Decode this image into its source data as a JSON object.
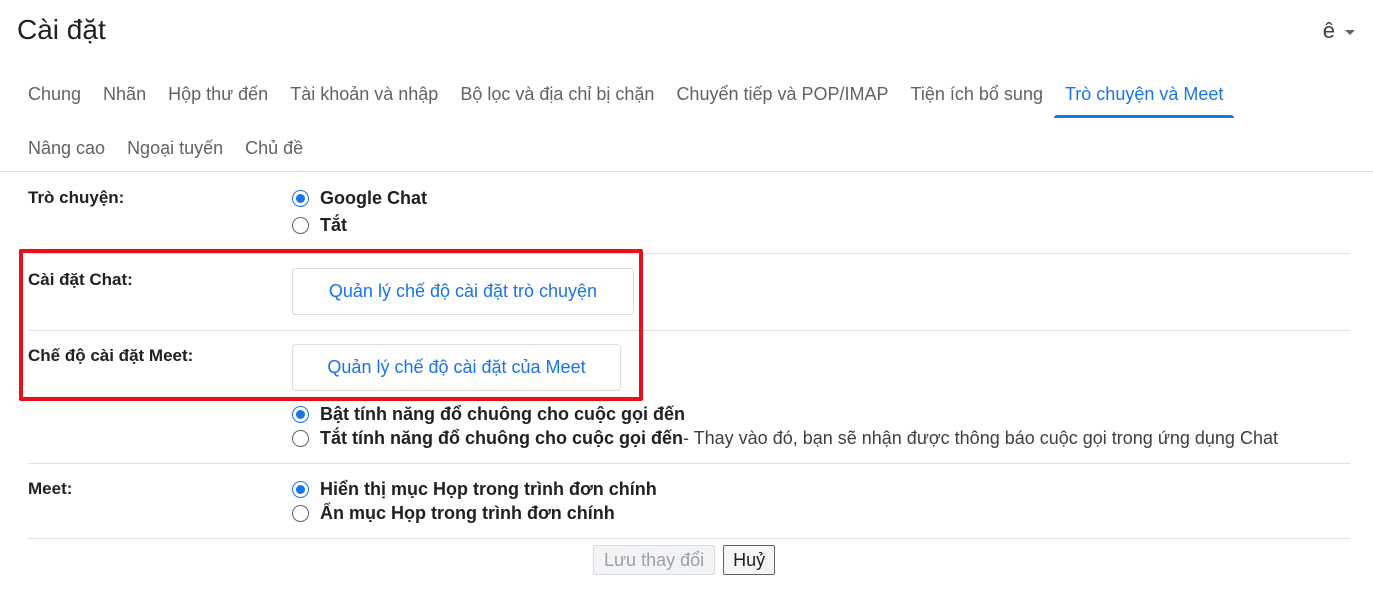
{
  "header": {
    "title": "Cài đặt",
    "lang_indicator": "ê"
  },
  "tabs": {
    "row1": [
      {
        "label": "Chung",
        "active": false
      },
      {
        "label": "Nhãn",
        "active": false
      },
      {
        "label": "Hộp thư đến",
        "active": false
      },
      {
        "label": "Tài khoản và nhập",
        "active": false
      },
      {
        "label": "Bộ lọc và địa chỉ bị chặn",
        "active": false
      },
      {
        "label": "Chuyển tiếp và POP/IMAP",
        "active": false
      },
      {
        "label": "Tiện ích bổ sung",
        "active": false
      },
      {
        "label": "Trò chuyện và Meet",
        "active": true
      }
    ],
    "row2": [
      {
        "label": "Nâng cao",
        "active": false
      },
      {
        "label": "Ngoại tuyến",
        "active": false
      },
      {
        "label": "Chủ đề",
        "active": false
      }
    ]
  },
  "chat": {
    "label": "Trò chuyện:",
    "options": [
      {
        "label": "Google Chat",
        "checked": true
      },
      {
        "label": "Tắt",
        "checked": false
      }
    ]
  },
  "chat_settings": {
    "label": "Cài đặt Chat:",
    "button": "Quản lý chế độ cài đặt trò chuyện"
  },
  "meet_settings": {
    "label": "Chế độ cài đặt Meet:",
    "button": "Quản lý chế độ cài đặt của Meet"
  },
  "ringing": {
    "options": [
      {
        "label": "Bật tính năng đổ chuông cho cuộc gọi đến",
        "desc": "",
        "checked": true
      },
      {
        "label": "Tắt tính năng đổ chuông cho cuộc gọi đến",
        "desc": " - Thay vào đó, bạn sẽ nhận được thông báo cuộc gọi trong ứng dụng Chat",
        "checked": false
      }
    ]
  },
  "meet": {
    "label": "Meet:",
    "options": [
      {
        "label": "Hiển thị mục Họp trong trình đơn chính",
        "checked": true
      },
      {
        "label": "Ẩn mục Họp trong trình đơn chính",
        "checked": false
      }
    ]
  },
  "footer": {
    "save": "Lưu thay đổi",
    "cancel": "Huỷ"
  },
  "colors": {
    "accent": "#1a73e8",
    "highlight": "#e8101b"
  }
}
